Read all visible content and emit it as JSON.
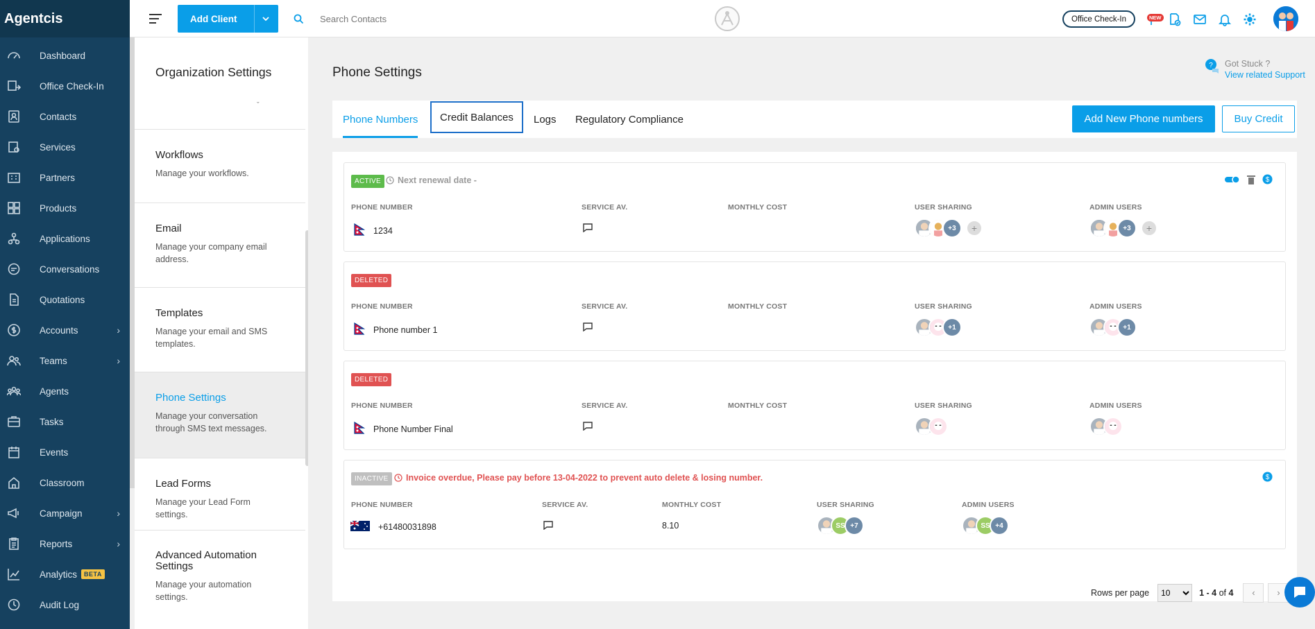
{
  "brand": "Agentcis",
  "nav": [
    {
      "label": "Dashboard",
      "icon": "dashboard-icon",
      "chevron": false
    },
    {
      "label": "Office Check-In",
      "icon": "office-checkin-icon",
      "chevron": false
    },
    {
      "label": "Contacts",
      "icon": "contacts-icon",
      "chevron": false
    },
    {
      "label": "Services",
      "icon": "services-icon",
      "chevron": false
    },
    {
      "label": "Partners",
      "icon": "partners-icon",
      "chevron": false
    },
    {
      "label": "Products",
      "icon": "products-icon",
      "chevron": false
    },
    {
      "label": "Applications",
      "icon": "applications-icon",
      "chevron": false
    },
    {
      "label": "Conversations",
      "icon": "conversations-icon",
      "chevron": false
    },
    {
      "label": "Quotations",
      "icon": "quotations-icon",
      "chevron": false
    },
    {
      "label": "Accounts",
      "icon": "accounts-icon",
      "chevron": true
    },
    {
      "label": "Teams",
      "icon": "teams-icon",
      "chevron": true
    },
    {
      "label": "Agents",
      "icon": "agents-icon",
      "chevron": false
    },
    {
      "label": "Tasks",
      "icon": "tasks-icon",
      "chevron": false
    },
    {
      "label": "Events",
      "icon": "events-icon",
      "chevron": false
    },
    {
      "label": "Classroom",
      "icon": "classroom-icon",
      "chevron": false
    },
    {
      "label": "Campaign",
      "icon": "campaign-icon",
      "chevron": true
    },
    {
      "label": "Reports",
      "icon": "reports-icon",
      "chevron": true
    },
    {
      "label": "Analytics",
      "icon": "analytics-icon",
      "chevron": false,
      "badge": "BETA"
    },
    {
      "label": "Audit Log",
      "icon": "audit-log-icon",
      "chevron": false
    }
  ],
  "topbar": {
    "add_client": "Add Client",
    "search_placeholder": "Search Contacts",
    "office_checkin": "Office Check-In",
    "new_badge": "NEW"
  },
  "settings": {
    "title": "Organization Settings",
    "items": [
      {
        "title": "Workflows",
        "desc": "Manage your workflows.",
        "active": false
      },
      {
        "title": "Email",
        "desc": "Manage your company email address.",
        "active": false
      },
      {
        "title": "Templates",
        "desc": "Manage your email and SMS templates.",
        "active": false
      },
      {
        "title": "Phone Settings",
        "desc": "Manage your conversation through SMS text messages.",
        "active": true
      },
      {
        "title": "Lead Forms",
        "desc": "Manage your Lead Form settings.",
        "active": false
      },
      {
        "title": "Advanced Automation Settings",
        "desc": "Manage your automation settings.",
        "active": false
      }
    ]
  },
  "main": {
    "title": "Phone Settings",
    "support": {
      "label": "Got Stuck ?",
      "link": "View related Support"
    },
    "tabs": [
      "Phone Numbers",
      "Credit Balances",
      "Logs",
      "Regulatory Compliance"
    ],
    "add_button": "Add New Phone numbers",
    "buy_button": "Buy Credit",
    "headers": {
      "phone": "PHONE NUMBER",
      "service": "SERVICE AV.",
      "cost": "MONTHLY COST",
      "sharing": "USER SHARING",
      "admin": "ADMIN USERS"
    },
    "cards": [
      {
        "status": "ACTIVE",
        "note": "Next renewal date -",
        "number": "1234",
        "flag": "nepal",
        "cost": "",
        "sharing_more": "+3",
        "admin_more": "+3"
      },
      {
        "status": "DELETED",
        "note": "",
        "number": "Phone number 1",
        "flag": "nepal",
        "cost": "",
        "sharing_more": "+1",
        "admin_more": "+1"
      },
      {
        "status": "DELETED",
        "note": "",
        "number": "Phone Number Final",
        "flag": "nepal",
        "cost": "",
        "sharing_more": "",
        "admin_more": ""
      },
      {
        "status": "INACTIVE",
        "note": "Invoice overdue, Please pay before 13-04-2022 to prevent auto delete & losing number.",
        "number": "+61480031898",
        "flag": "australia",
        "cost": "8.10",
        "sharing_more": "+7",
        "admin_more": "+4",
        "initials": "SS"
      }
    ],
    "pager": {
      "rows_label": "Rows per page",
      "rows_value": "10",
      "range": "1 - 4",
      "of": "of",
      "total": "4"
    }
  },
  "colors": {
    "primary": "#0a9ee8",
    "sidebar": "#16415f",
    "active": "#5dbb4b",
    "deleted": "#e05252",
    "inactive": "#bfbfbf"
  }
}
